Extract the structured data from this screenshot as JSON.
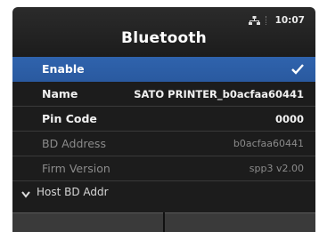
{
  "status": {
    "time": "10:07",
    "icons": [
      "network-icon"
    ]
  },
  "header": {
    "title": "Bluetooth"
  },
  "items": [
    {
      "label": "Enable",
      "value": "",
      "state": "selected",
      "checked": true
    },
    {
      "label": "Name",
      "value": "SATO PRINTER_b0acfaa60441",
      "state": "normal"
    },
    {
      "label": "Pin Code",
      "value": "0000",
      "state": "normal"
    },
    {
      "label": "BD Address",
      "value": "b0acfaa60441",
      "state": "disabled"
    },
    {
      "label": "Firm Version",
      "value": "spp3  v2.00",
      "state": "disabled"
    }
  ],
  "group": {
    "label": "Host BD Addr",
    "icon": "chevron-down-icon"
  },
  "colors": {
    "selected": "#2d5fa6",
    "background": "#1c1c1c"
  }
}
